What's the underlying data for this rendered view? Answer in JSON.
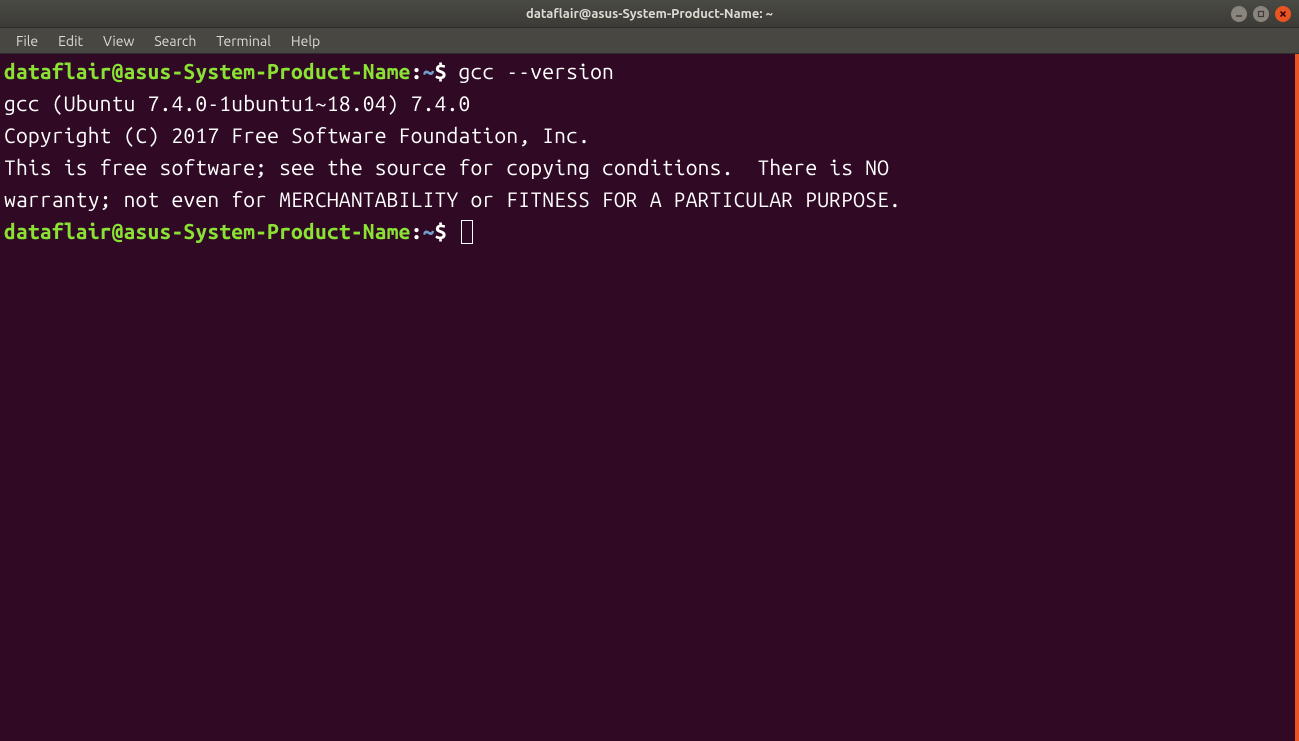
{
  "window": {
    "title": "dataflair@asus-System-Product-Name: ~"
  },
  "menubar": {
    "items": [
      "File",
      "Edit",
      "View",
      "Search",
      "Terminal",
      "Help"
    ]
  },
  "prompt": {
    "user_host": "dataflair@asus-System-Product-Name",
    "colon": ":",
    "path": "~",
    "dollar": "$"
  },
  "terminal": {
    "command1": " gcc --version",
    "output_lines": [
      "gcc (Ubuntu 7.4.0-1ubuntu1~18.04) 7.4.0",
      "Copyright (C) 2017 Free Software Foundation, Inc.",
      "This is free software; see the source for copying conditions.  There is NO",
      "warranty; not even for MERCHANTABILITY or FITNESS FOR A PARTICULAR PURPOSE.",
      ""
    ]
  }
}
